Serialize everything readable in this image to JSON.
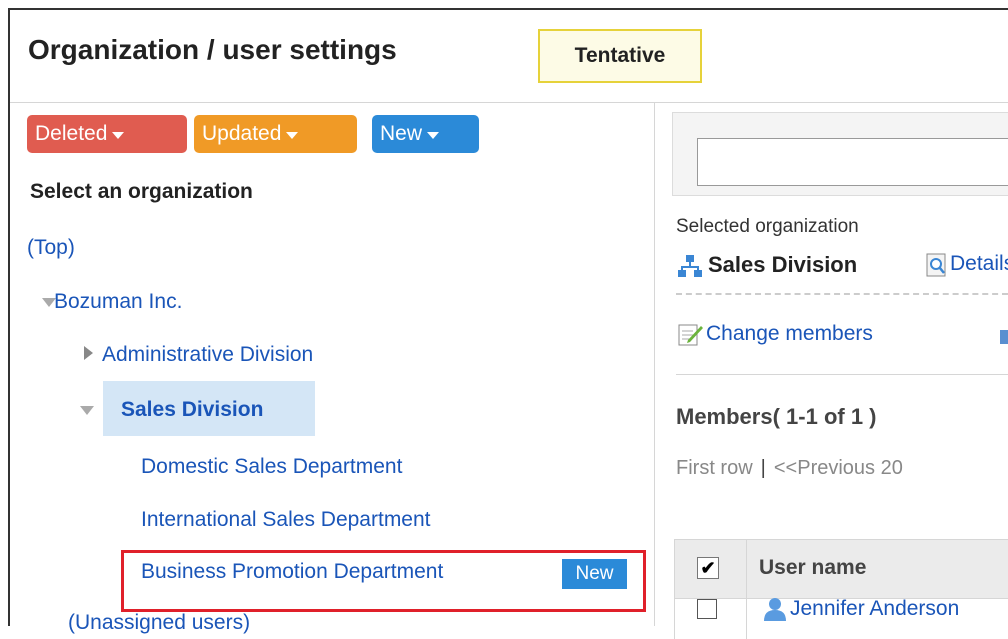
{
  "header": {
    "title": "Organization / user settings",
    "status_badge": "Tentative"
  },
  "filters": {
    "deleted_label": "Deleted",
    "updated_label": "Updated",
    "new_label": "New"
  },
  "tree": {
    "heading": "Select an organization",
    "top_label": "(Top)",
    "root_label": "Bozuman Inc.",
    "items": [
      {
        "label": "Administrative Division"
      },
      {
        "label": "Sales Division"
      },
      {
        "label": "Domestic Sales Department"
      },
      {
        "label": "International Sales Department"
      },
      {
        "label": "Business Promotion Department",
        "tag": "New"
      }
    ],
    "unassigned_label": "(Unassigned users)"
  },
  "detail": {
    "selected_label": "Selected organization",
    "org_name": "Sales Division",
    "detail_link": "Details",
    "change_members": "Change members",
    "members_title": "Members( 1-1 of 1 )",
    "pager": {
      "first": "First row",
      "sep": "|",
      "prev": "<<Previous 20"
    },
    "table": {
      "column_username": "User name",
      "header_check": "✔",
      "rows": [
        {
          "user": "Jennifer Anderson"
        }
      ]
    }
  },
  "colors": {
    "deleted": "#e05c50",
    "updated": "#f09a26",
    "new": "#2b8ad8",
    "link": "#1a55b8",
    "selected_bg": "#d4e6f6",
    "highlight": "#e0202a"
  }
}
